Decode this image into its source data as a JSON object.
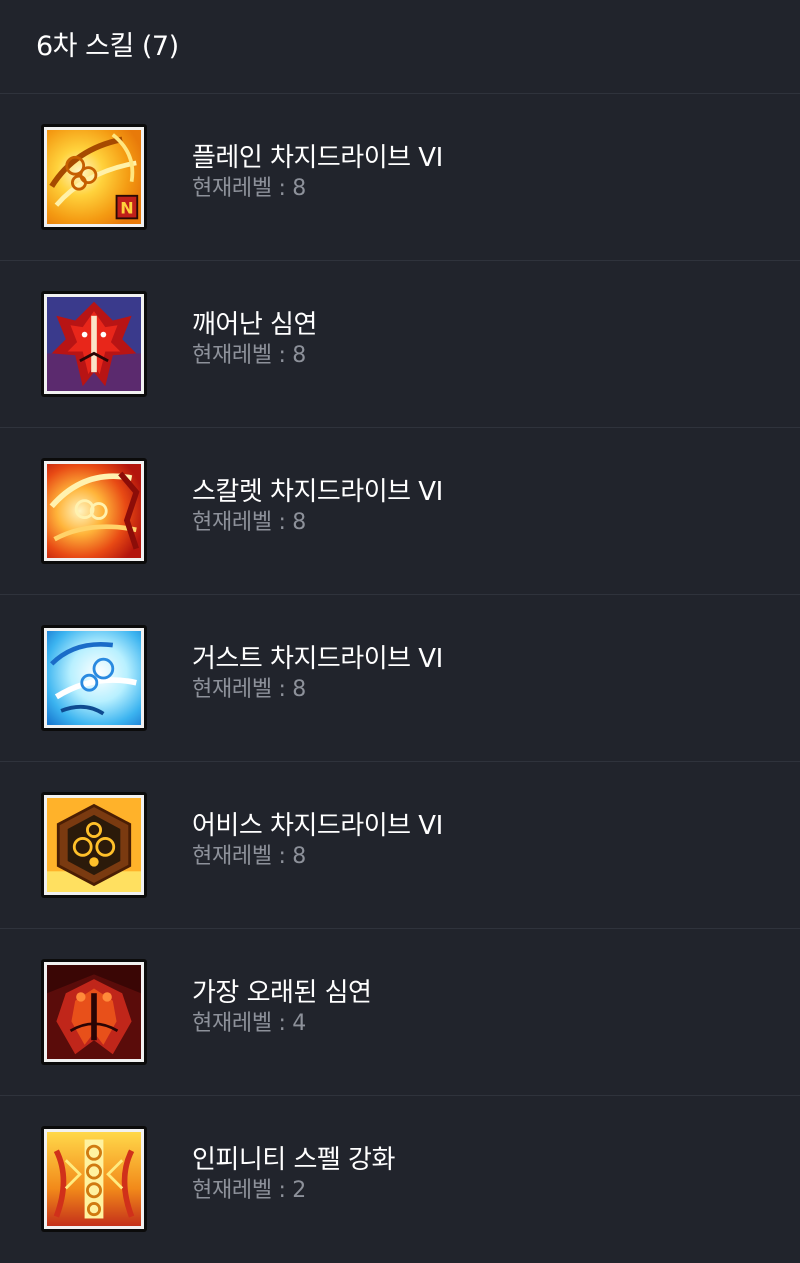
{
  "header": {
    "title": "6차 스킬 (7)"
  },
  "skills": [
    {
      "name": "플레인 차지드라이브 VI",
      "level_text": "현재레벨 : 8",
      "icon": "plain-chargedrive-icon"
    },
    {
      "name": "깨어난 심연",
      "level_text": "현재레벨 : 8",
      "icon": "awakened-abyss-icon"
    },
    {
      "name": "스칼렛 차지드라이브 VI",
      "level_text": "현재레벨 : 8",
      "icon": "scarlet-chargedrive-icon"
    },
    {
      "name": "거스트 차지드라이브 VI",
      "level_text": "현재레벨 : 8",
      "icon": "gust-chargedrive-icon"
    },
    {
      "name": "어비스 차지드라이브 VI",
      "level_text": "현재레벨 : 8",
      "icon": "abyss-chargedrive-icon"
    },
    {
      "name": "가장 오래된 심연",
      "level_text": "현재레벨 : 4",
      "icon": "oldest-abyss-icon"
    },
    {
      "name": "인피니티 스펠 강화",
      "level_text": "현재레벨 : 2",
      "icon": "infinity-spell-icon"
    }
  ],
  "badge": "N"
}
